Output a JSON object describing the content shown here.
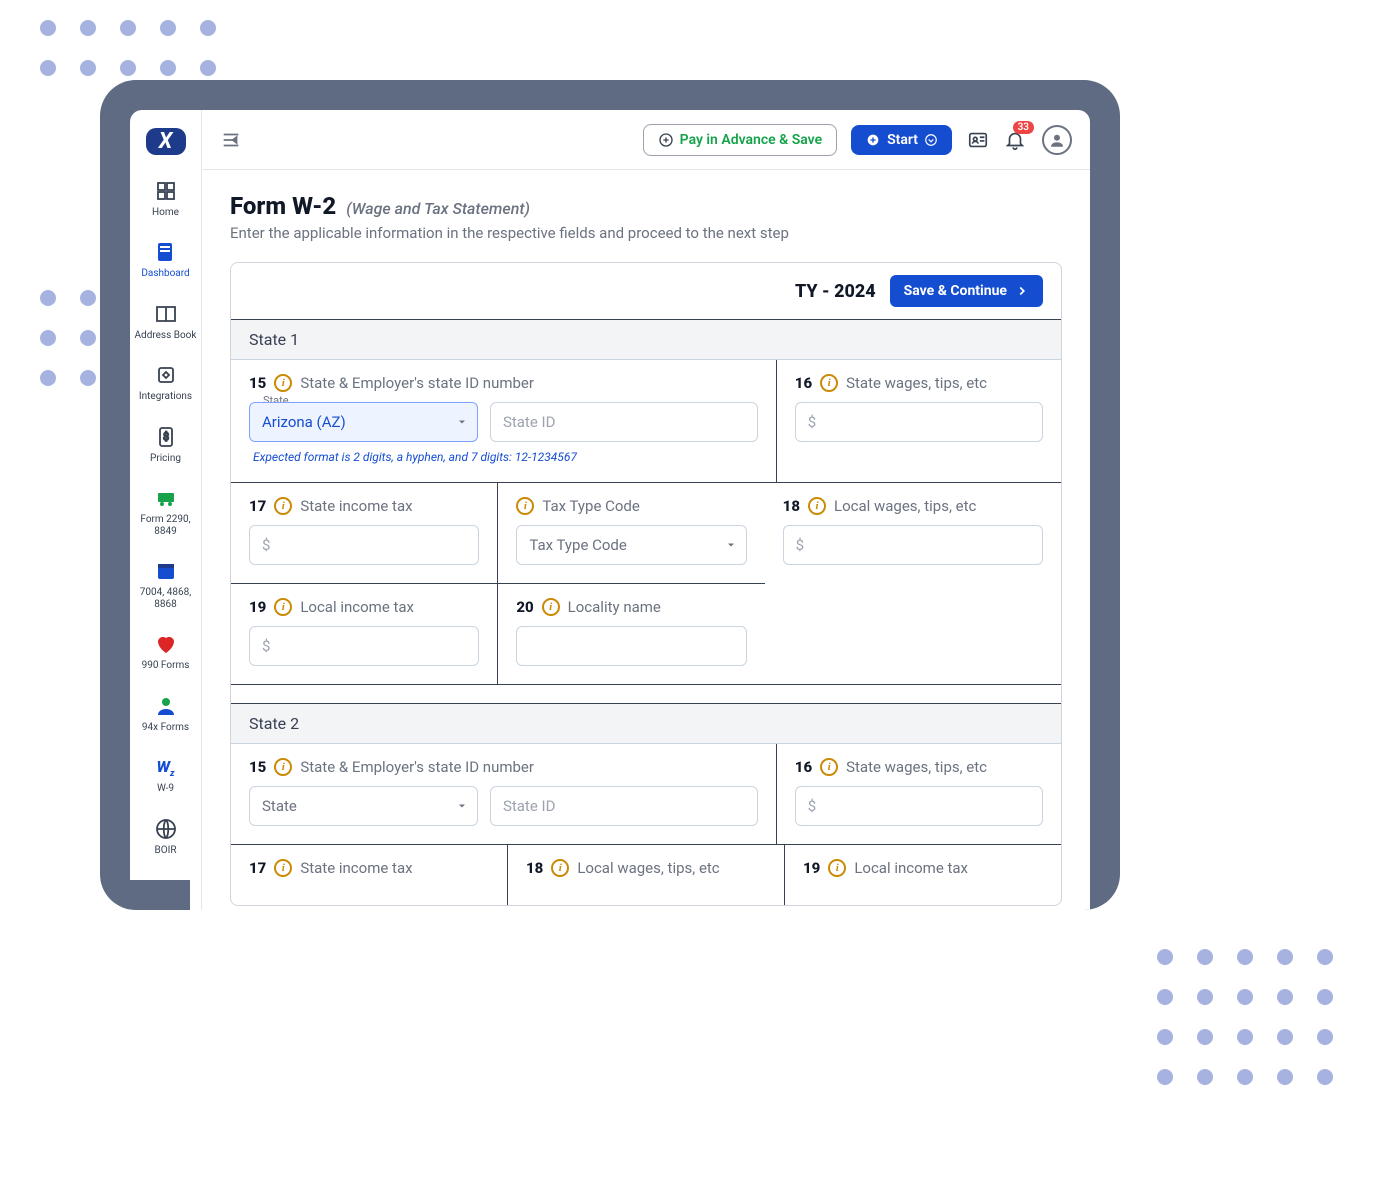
{
  "brand": {
    "logo_letter": "X"
  },
  "sidebar": {
    "items": [
      {
        "label": "Home"
      },
      {
        "label": "Dashboard"
      },
      {
        "label": "Address Book"
      },
      {
        "label": "Integrations"
      },
      {
        "label": "Pricing"
      },
      {
        "label": "Form 2290, 8849"
      },
      {
        "label": "7004, 4868, 8868"
      },
      {
        "label": "990 Forms"
      },
      {
        "label": "94x Forms"
      },
      {
        "label": "W-9"
      },
      {
        "label": "BOIR"
      }
    ]
  },
  "topbar": {
    "pay_in_advance": "Pay in Advance & Save",
    "start": "Start",
    "notification_count": "33"
  },
  "page": {
    "title": "Form W-2",
    "subtitle": "(Wage and Tax Statement)",
    "description": "Enter the applicable information in the respective fields and proceed to the next step",
    "tax_year": "TY - 2024",
    "save_continue": "Save & Continue"
  },
  "state1": {
    "heading": "State 1",
    "box15_num": "15",
    "box15_label": "State & Employer's state ID number",
    "state_floating": "State",
    "state_value": "Arizona (AZ)",
    "state_id_placeholder": "State ID",
    "hint": "Expected format is 2 digits, a hyphen, and 7 digits: 12-1234567",
    "box16_num": "16",
    "box16_label": "State wages, tips, etc",
    "box17_num": "17",
    "box17_label": "State income tax",
    "tax_type_label": "Tax Type Code",
    "tax_type_placeholder": "Tax Type Code",
    "box18_num": "18",
    "box18_label": "Local wages, tips, etc",
    "box19_num": "19",
    "box19_label": "Local income tax",
    "box20_num": "20",
    "box20_label": "Locality name",
    "dollar": "$"
  },
  "state2": {
    "heading": "State 2",
    "box15_num": "15",
    "box15_label": "State & Employer's state ID number",
    "state_placeholder": "State",
    "state_id_placeholder": "State ID",
    "box16_num": "16",
    "box16_label": "State wages, tips, etc",
    "box17_num": "17",
    "box17_label": "State income tax",
    "box18_num": "18",
    "box18_label": "Local wages, tips, etc",
    "box19_num": "19",
    "box19_label": "Local income tax",
    "dollar": "$"
  }
}
